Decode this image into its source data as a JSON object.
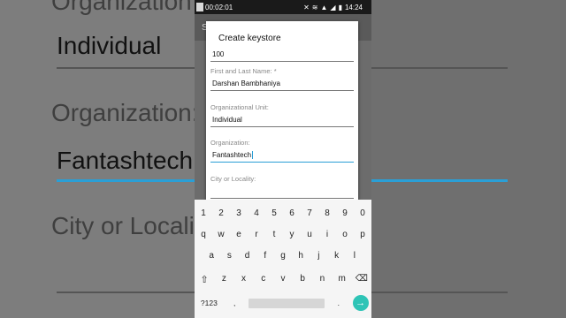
{
  "status": {
    "time": "00:02:01",
    "clock": "14:24",
    "icons": [
      "mute-icon",
      "wifi-icon",
      "signal-icon",
      "4g-icon",
      "battery-icon"
    ]
  },
  "appbar": {
    "label": "S"
  },
  "dialog": {
    "title": "Create keystore",
    "alias_value": "100",
    "fields": [
      {
        "label": "First and Last Name: *",
        "value": "Darshan Bambhaniya"
      },
      {
        "label": "Organizational Unit:",
        "value": "Individual"
      },
      {
        "label": "Organization:",
        "value": "Fantashtech"
      },
      {
        "label": "City or Locality:",
        "value": ""
      }
    ]
  },
  "keyboard": {
    "row1": [
      "1",
      "2",
      "3",
      "4",
      "5",
      "6",
      "7",
      "8",
      "9",
      "0"
    ],
    "row2": [
      "q",
      "w",
      "e",
      "r",
      "t",
      "y",
      "u",
      "i",
      "o",
      "p"
    ],
    "row3": [
      "a",
      "s",
      "d",
      "f",
      "g",
      "h",
      "j",
      "k",
      "l"
    ],
    "row4": [
      "z",
      "x",
      "c",
      "v",
      "b",
      "n",
      "m"
    ],
    "symbols": "?123",
    "comma": ",",
    "period": "."
  },
  "background": {
    "org_unit_value": "Individual",
    "org_label": "Organization:",
    "org_value": "Fantashtech",
    "city_label": "City or Localit",
    "top_label": "Organization"
  },
  "colors": {
    "accent": "#2a9fd6",
    "enter": "#2ec4b6"
  }
}
